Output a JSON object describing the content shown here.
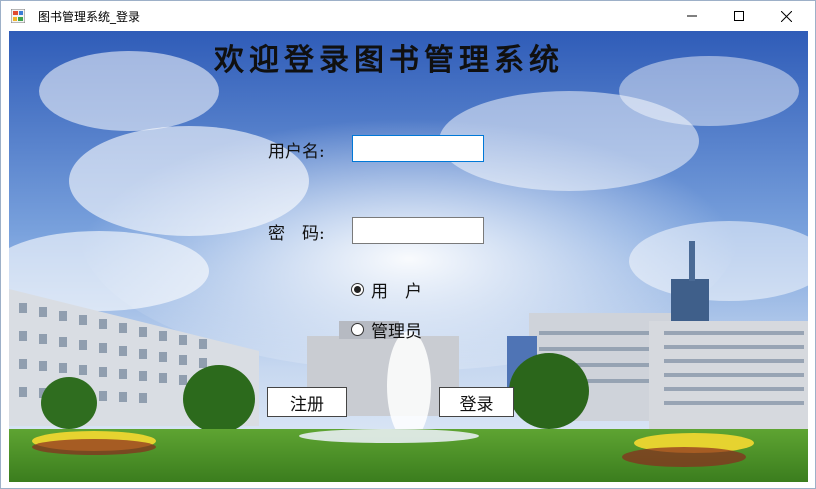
{
  "window": {
    "title": "图书管理系统_登录"
  },
  "heading": "欢迎登录图书管理系统",
  "form": {
    "username_label": "用户名:",
    "username_value": "",
    "password_label": "密　码:",
    "password_value": ""
  },
  "role": {
    "options": [
      "用　户",
      "管理员"
    ],
    "selected": "用　户"
  },
  "buttons": {
    "register": "注册",
    "login": "登录"
  },
  "colors": {
    "focus_border": "#0078d7",
    "sky": "#3f6fc4"
  }
}
